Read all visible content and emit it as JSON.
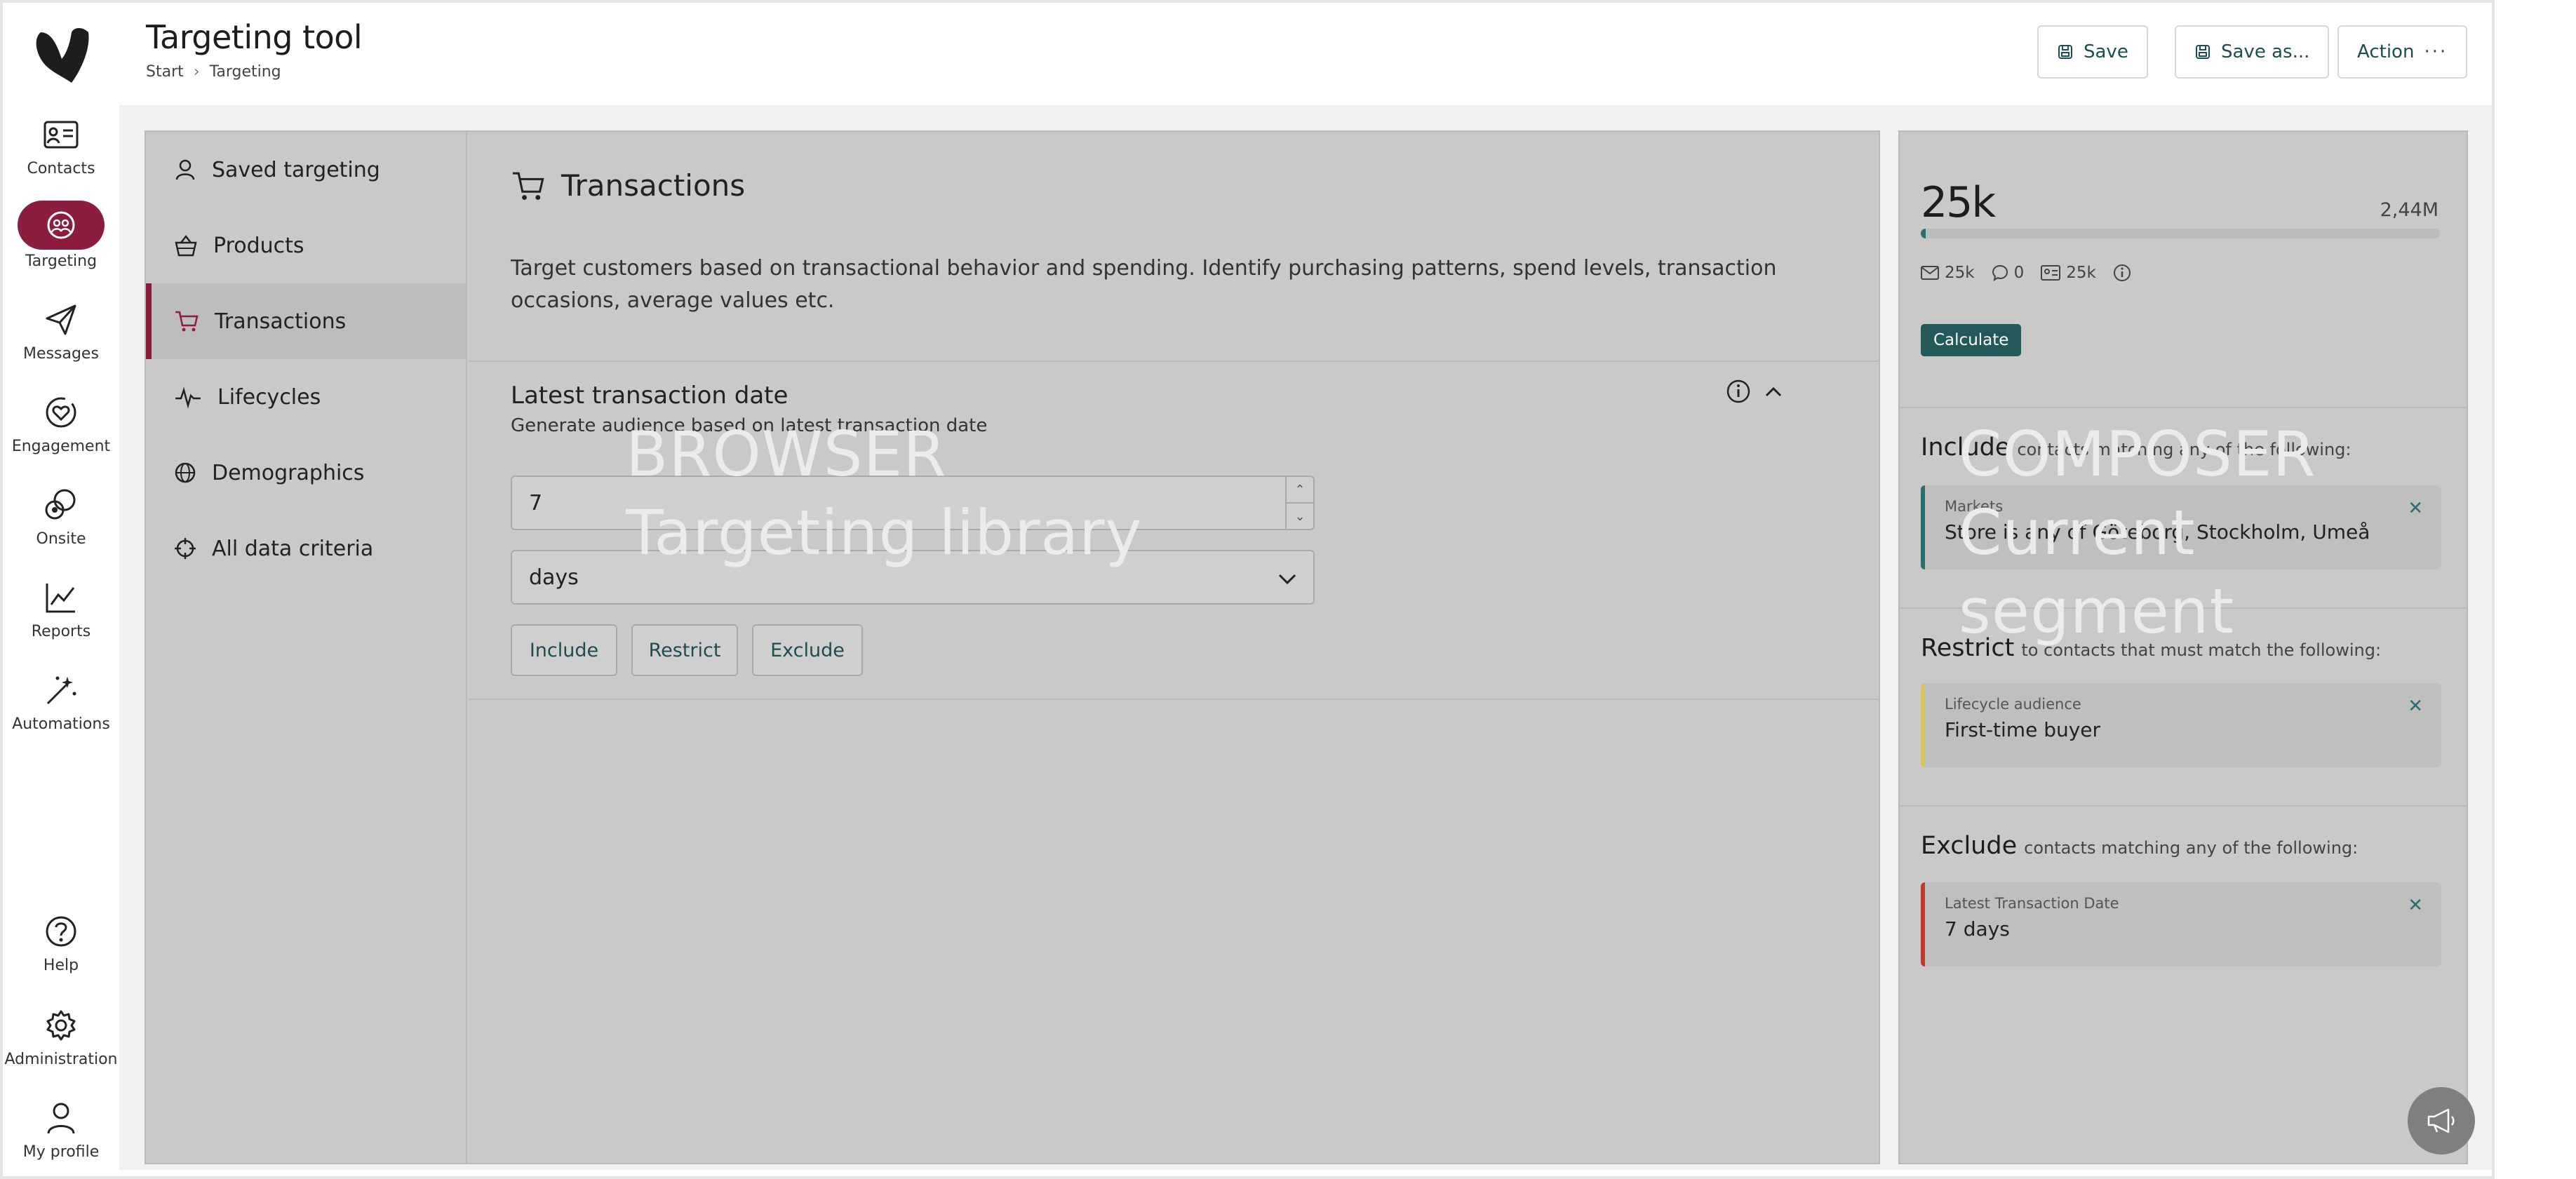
{
  "app": {
    "title": "Targeting tool",
    "breadcrumb": [
      "Start",
      "Targeting"
    ]
  },
  "header_buttons": {
    "save": "Save",
    "save_as": "Save as...",
    "action": "Action"
  },
  "rail": {
    "items": [
      {
        "label": "Contacts",
        "icon": "contact-card-icon"
      },
      {
        "label": "Targeting",
        "icon": "targeting-icon",
        "active": true
      },
      {
        "label": "Messages",
        "icon": "send-icon"
      },
      {
        "label": "Engagement",
        "icon": "heart-icon"
      },
      {
        "label": "Onsite",
        "icon": "onsite-icon"
      },
      {
        "label": "Reports",
        "icon": "chart-icon"
      },
      {
        "label": "Automations",
        "icon": "magic-wand-icon"
      }
    ],
    "bottom": [
      {
        "label": "Help",
        "icon": "help-icon"
      },
      {
        "label": "Administration",
        "icon": "gear-icon"
      },
      {
        "label": "My profile",
        "icon": "user-icon"
      }
    ]
  },
  "browser": {
    "overlay_label": "BROWSER",
    "overlay_title": "Targeting library",
    "menu": [
      {
        "label": "Saved targeting",
        "icon": "user-icon"
      },
      {
        "label": "Products",
        "icon": "basket-icon"
      },
      {
        "label": "Transactions",
        "icon": "cart-icon",
        "active": true
      },
      {
        "label": "Lifecycles",
        "icon": "pulse-icon"
      },
      {
        "label": "Demographics",
        "icon": "globe-icon"
      },
      {
        "label": "All data criteria",
        "icon": "crosshair-icon"
      }
    ],
    "content": {
      "title": "Transactions",
      "description": "Target customers based on transactional behavior and spending. Identify purchasing patterns, spend levels, transaction occasions, average values etc.",
      "section": {
        "title": "Latest transaction date",
        "subtitle": "Generate audience based on latest transaction date",
        "number_value": "7",
        "unit_value": "days",
        "buttons": [
          "Include",
          "Restrict",
          "Exclude"
        ]
      }
    }
  },
  "composer": {
    "overlay_label": "COMPOSER",
    "overlay_title": "Current segment",
    "count": "25k",
    "total": "2,44M",
    "progress": 0.01,
    "stats": {
      "email": "25k",
      "sms": "0",
      "other": "25k"
    },
    "calculate": "Calculate",
    "include": {
      "title": "Include",
      "sub": "contacts matching any of the following:",
      "card_key": "Markets",
      "card_value": "Store is any of Göteborg, Stockholm, Umeå"
    },
    "restrict": {
      "title": "Restrict",
      "sub": "to contacts that must match the following:",
      "card_key": "Lifecycle audience",
      "card_value": "First-time buyer"
    },
    "exclude": {
      "title": "Exclude",
      "sub": "contacts matching any of the following:",
      "card_key": "Latest Transaction Date",
      "card_value": "7 days"
    },
    "colors": {
      "include": "#2b6e70",
      "restrict": "#d8c25b",
      "exclude": "#c0392b"
    }
  }
}
